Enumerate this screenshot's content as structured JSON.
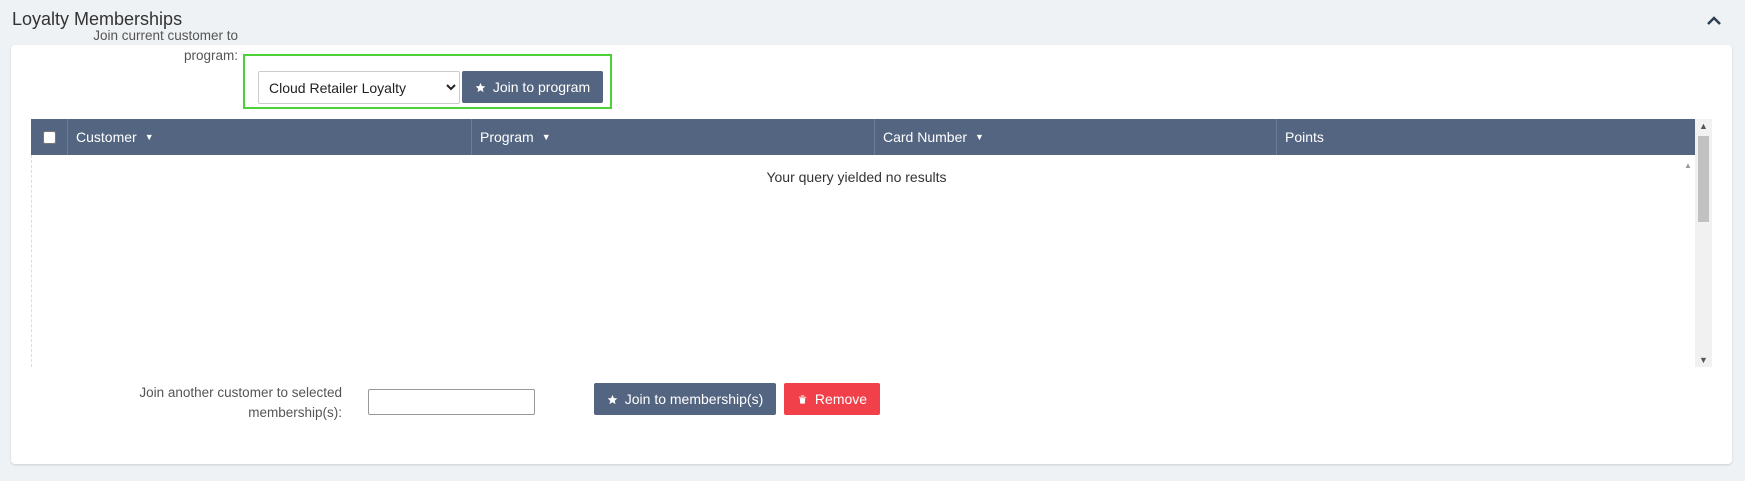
{
  "section": {
    "title": "Loyalty Memberships",
    "collapse_icon": "chevron-up-icon"
  },
  "join_current": {
    "label": "Join current customer to program:",
    "selected_program": "Cloud Retailer Loyalty",
    "button_label": "Join to program",
    "button_icon": "star-icon"
  },
  "table": {
    "columns": [
      "Customer",
      "Program",
      "Card Number",
      "Points"
    ],
    "empty_message": "Your query yielded no results",
    "header_color": "#536580"
  },
  "join_another": {
    "label": "Join another customer to selected membership(s):",
    "input_value": "",
    "join_button_label": "Join to membership(s)",
    "join_button_icon": "star-icon",
    "remove_button_label": "Remove",
    "remove_button_icon": "trash-icon"
  },
  "colors": {
    "primary": "#536580",
    "danger": "#f2404a",
    "highlight": "#4cd137"
  }
}
